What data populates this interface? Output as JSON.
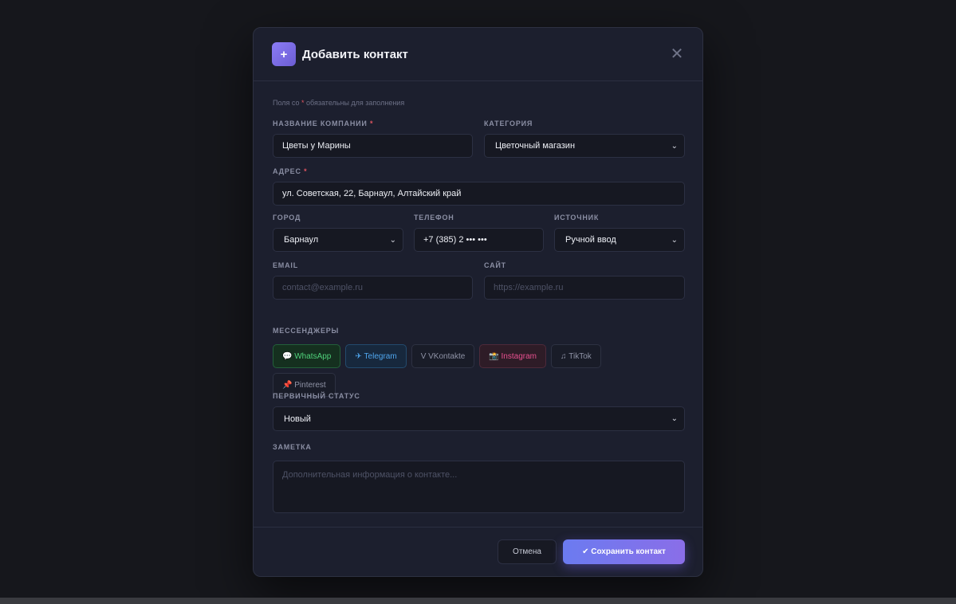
{
  "modal": {
    "title": "Добавить контакт",
    "header_icon": "+",
    "close_glyph": "✕"
  },
  "hint": {
    "before": "Поля со ",
    "star": "*",
    "after": " обязательны для заполнения"
  },
  "fields": {
    "company": {
      "label": "Название компании",
      "required": "*",
      "value": "Цветы у Марины"
    },
    "category": {
      "label": "Категория",
      "value": "Цветочный магазин"
    },
    "address": {
      "label": "Адрес",
      "required": "*",
      "value": "ул. Советская, 22, Барнаул, Алтайский край"
    },
    "city": {
      "label": "Город",
      "value": "Барнаул"
    },
    "phone": {
      "label": "Телефон",
      "value": "+7 (385) 2 ••• •••"
    },
    "source": {
      "label": "Источник",
      "value": "Ручной ввод"
    },
    "email": {
      "label": "Email",
      "placeholder": "contact@example.ru"
    },
    "site": {
      "label": "Сайт",
      "placeholder": "https://example.ru"
    },
    "status": {
      "label": "Первичный статус",
      "value": "Новый"
    },
    "note": {
      "label": "Заметка",
      "placeholder": "Дополнительная информация о контакте..."
    }
  },
  "messengers": {
    "label": "Мессенджеры",
    "items": [
      {
        "icon": "💬",
        "name": "WhatsApp"
      },
      {
        "icon": "✈",
        "name": "Telegram"
      },
      {
        "icon": "V",
        "name": "VKontakte"
      },
      {
        "icon": "📸",
        "name": "Instagram"
      },
      {
        "icon": "♫",
        "name": "TikTok"
      },
      {
        "icon": "📌",
        "name": "Pinterest"
      }
    ]
  },
  "footer": {
    "cancel_label": "Отмена",
    "save_label": "✔ Сохранить контакт"
  },
  "colors": {
    "accent": "#7b6ff0",
    "required": "#e05561",
    "whatsapp": "#4fd07a",
    "telegram": "#4fa6ee",
    "instagram": "#e8508f"
  }
}
